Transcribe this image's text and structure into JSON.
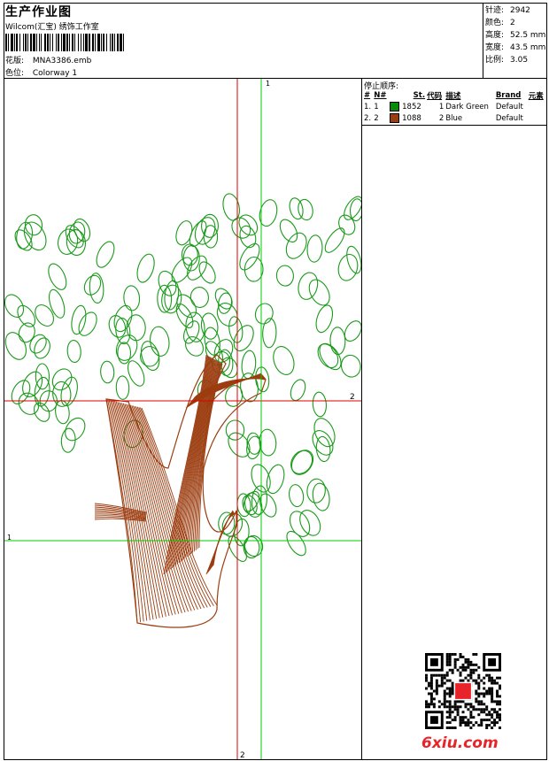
{
  "header": {
    "title": "生产作业图",
    "subtitle": "Wilcom(汇宝) 绣饰工作室",
    "design_label": "花版:",
    "design_value": "MNA3386.emb",
    "colorway_label": "色位:",
    "colorway_value": "Colorway 1"
  },
  "stats": [
    {
      "label": "针迹:",
      "value": "2942"
    },
    {
      "label": "颜色:",
      "value": "2"
    },
    {
      "label": "高度:",
      "value": "52.5 mm"
    },
    {
      "label": "宽度:",
      "value": "43.5 mm"
    },
    {
      "label": "比例:",
      "value": "3.05"
    }
  ],
  "stop_sequence": {
    "title": "停止顺序:",
    "columns": [
      "#",
      "N#",
      "St.",
      "代码",
      "描述",
      "Brand",
      "元素"
    ],
    "rows": [
      {
        "index": "1.",
        "n": "1",
        "color": "#0a8a0a",
        "stitches": "1852",
        "code": "1",
        "description": "Dark Green",
        "brand": "Default"
      },
      {
        "index": "2.",
        "n": "2",
        "color": "#9c3d10",
        "stitches": "1088",
        "code": "2",
        "description": "Blue",
        "brand": "Default"
      }
    ]
  },
  "canvas": {
    "axis_labels": {
      "top_green": "1",
      "right_red": "2",
      "left_green": "1",
      "bottom_red": "2"
    },
    "leaf_color": "#1a9a1a",
    "trunk_color": "#9c3d10",
    "axis_red": "#e00000",
    "axis_green": "#00cc00"
  },
  "watermark": {
    "text": "6xiu.com"
  }
}
